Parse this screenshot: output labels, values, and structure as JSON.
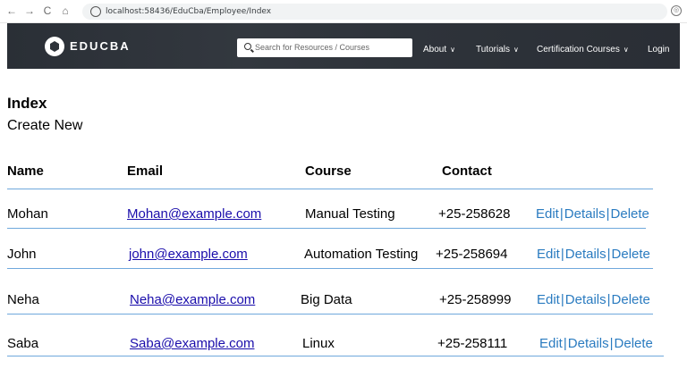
{
  "browser": {
    "url": "localhost:58436/EduCba/Employee/Index",
    "back_glyph": "←",
    "forward_glyph": "→",
    "reload_glyph": "C",
    "home_glyph": "⌂",
    "ext_glyph": "◎"
  },
  "header": {
    "logo_text": "EDUCBA",
    "search_placeholder": "Search for Resources / Courses",
    "nav": [
      {
        "label": "About"
      },
      {
        "label": "Tutorials"
      },
      {
        "label": "Certification Courses"
      },
      {
        "label": "Login"
      }
    ],
    "chevron": "∨"
  },
  "page": {
    "title": "Index",
    "create_new": "Create New",
    "columns": [
      "Name",
      "Email",
      "Course",
      "Contact"
    ],
    "rows": [
      {
        "name": "Mohan",
        "email": "Mohan@example.com",
        "course": "Manual Testing",
        "contact": "+25-258628"
      },
      {
        "name": "John",
        "email": "john@example.com",
        "course": "Automation Testing",
        "contact": "+25-258694"
      },
      {
        "name": "Neha",
        "email": "Neha@example.com",
        "course": "Big Data",
        "contact": "+25-258999"
      },
      {
        "name": "Saba",
        "email": "Saba@example.com",
        "course": "Linux",
        "contact": "+25-258111"
      }
    ],
    "actions": {
      "edit": "Edit",
      "details": "Details",
      "delete": "Delete",
      "separator": "|"
    }
  }
}
